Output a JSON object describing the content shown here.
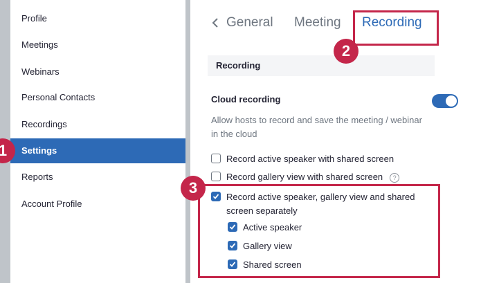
{
  "sidebar": {
    "items": [
      {
        "label": "Profile"
      },
      {
        "label": "Meetings"
      },
      {
        "label": "Webinars"
      },
      {
        "label": "Personal Contacts"
      },
      {
        "label": "Recordings"
      },
      {
        "label": "Settings",
        "active": true
      },
      {
        "label": "Reports"
      },
      {
        "label": "Account Profile"
      }
    ]
  },
  "tabs": {
    "back_icon": "chevron-left-icon",
    "items": [
      {
        "label": "General"
      },
      {
        "label": "Meeting"
      },
      {
        "label": "Recording",
        "active": true
      }
    ]
  },
  "section": {
    "title": "Recording"
  },
  "cloud_recording": {
    "title": "Cloud recording",
    "enabled": true,
    "description": "Allow hosts to record and save the meeting / webinar in the cloud",
    "options": [
      {
        "label": "Record active speaker with shared screen",
        "checked": false
      },
      {
        "label": "Record gallery view with shared screen",
        "checked": false,
        "help_icon": "?"
      },
      {
        "label": "Record active speaker, gallery view and shared screen separately",
        "checked": true
      },
      {
        "label": "Active speaker",
        "checked": true
      },
      {
        "label": "Gallery view",
        "checked": true
      },
      {
        "label": "Shared screen",
        "checked": true
      }
    ]
  },
  "annotations": {
    "steps": [
      "1",
      "2",
      "3"
    ],
    "color": "#c4264a"
  },
  "colors": {
    "accent": "#2d6ab6",
    "background": "#bfc4c9"
  }
}
